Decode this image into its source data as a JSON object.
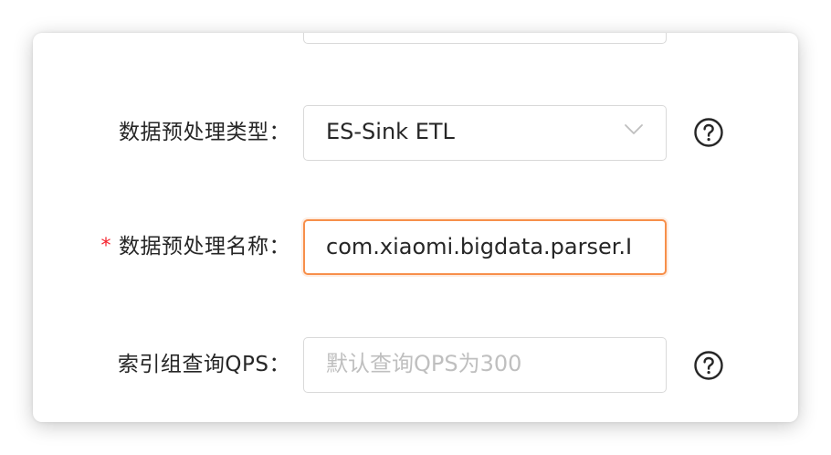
{
  "form": {
    "preprocess_type": {
      "label": "数据预处理类型：",
      "value": "ES-Sink ETL"
    },
    "preprocess_name": {
      "required_mark": "*",
      "label": "数据预处理名称：",
      "value": "com.xiaomi.bigdata.parser.I"
    },
    "index_qps": {
      "label": "索引组查询QPS：",
      "placeholder": "默认查询QPS为300"
    }
  },
  "icons": {
    "select_arrow": "chevron-down-icon",
    "help": "question-circle-icon"
  },
  "colors": {
    "focus_border": "#f78f4a",
    "required": "#f5222d",
    "placeholder": "#bfbfbf",
    "text": "#262626",
    "border": "#d9d9d9"
  }
}
